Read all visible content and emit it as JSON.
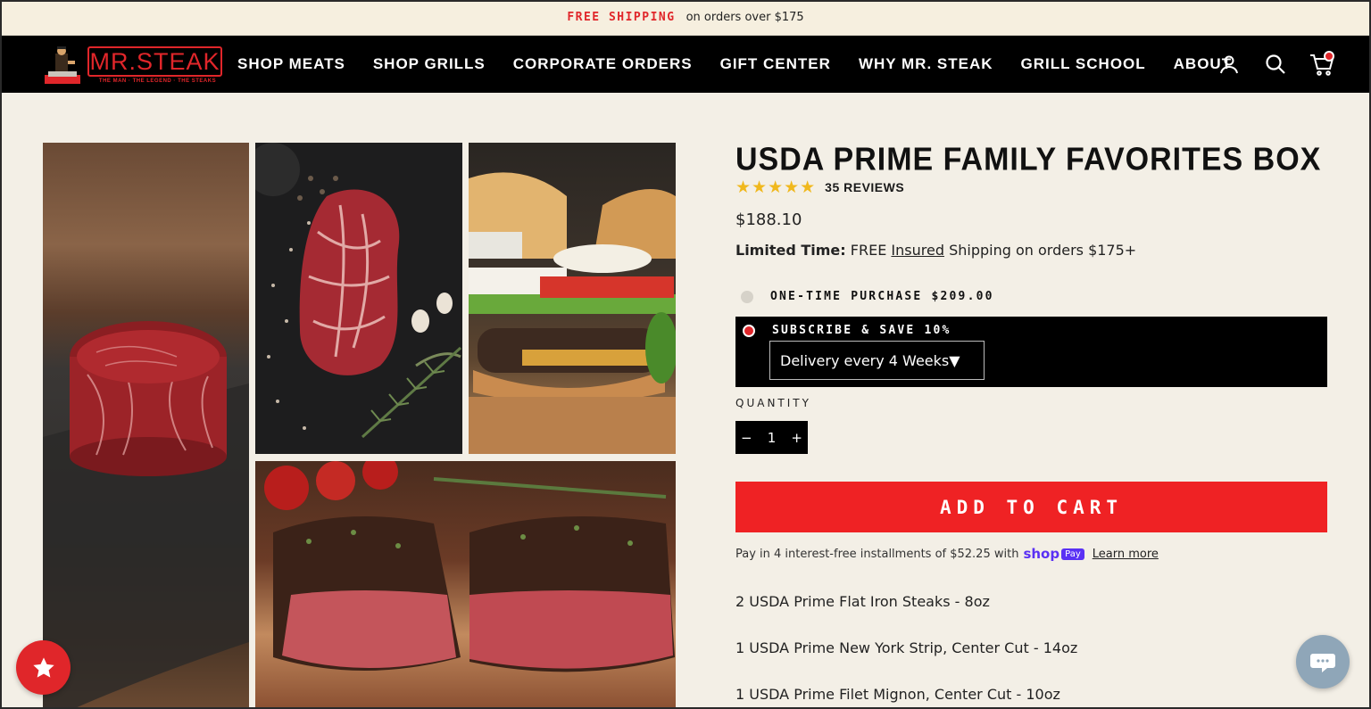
{
  "announcement": {
    "highlight": "FREE SHIPPING",
    "text": "on orders over $175"
  },
  "logo": {
    "text": "MR.STEAK",
    "tagline": "THE MAN · THE LEGEND · THE STEAKS"
  },
  "nav": [
    "SHOP MEATS",
    "SHOP GRILLS",
    "CORPORATE ORDERS",
    "GIFT CENTER",
    "WHY MR. STEAK",
    "GRILL SCHOOL",
    "ABOUT"
  ],
  "header_icons": [
    "account-icon",
    "search-icon",
    "cart-icon"
  ],
  "product": {
    "title": "USDA PRIME FAMILY FAVORITES BOX",
    "stars": "★★★★★",
    "reviews": "35 REVIEWS",
    "price": "$188.10",
    "limited_label": "Limited Time:",
    "limited_pre": "FREE",
    "limited_link": "Insured",
    "limited_post": "Shipping on orders $175+",
    "option_one_time": "ONE-TIME PURCHASE $209.00",
    "option_subscribe": "SUBSCRIBE & SAVE 10%",
    "delivery": "Delivery every 4 Weeks▼",
    "quantity_label": "QUANTITY",
    "quantity_minus": "−",
    "quantity_value": "1",
    "quantity_plus": "+",
    "add_to_cart": "ADD TO CART",
    "installments_text": "Pay in 4 interest-free installments of $52.25 with",
    "shop_word": "shop",
    "pay_word": "Pay",
    "learn_more": "Learn more",
    "items": [
      "2 USDA Prime Flat Iron Steaks - 8oz",
      "1 USDA Prime New York Strip, Center Cut - 14oz",
      "1 USDA Prime Filet Mignon, Center Cut - 10oz"
    ]
  },
  "colors": {
    "brand_red": "#e0262a",
    "button_red": "#ef2224",
    "star_gold": "#f0b81d",
    "shop_pay_purple": "#5a31f4",
    "background": "#f3efe6"
  }
}
